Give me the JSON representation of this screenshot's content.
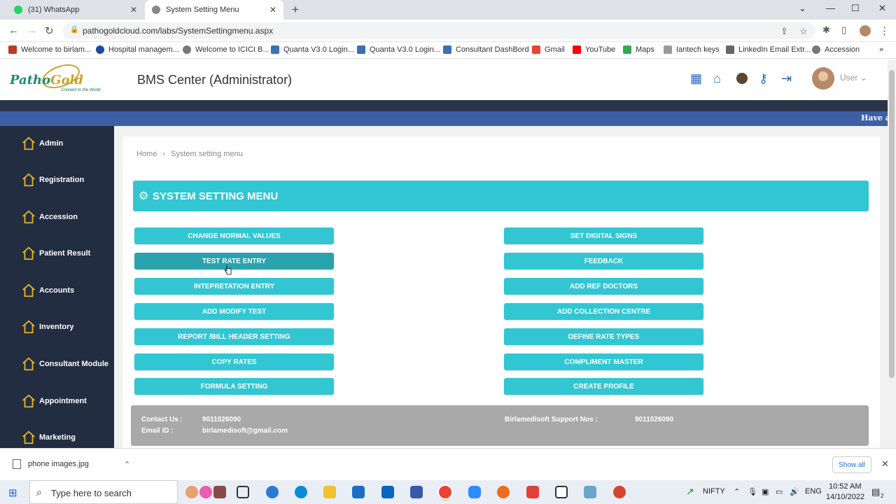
{
  "browser": {
    "tabs": [
      {
        "title": "(31) WhatsApp",
        "active": false
      },
      {
        "title": "System Setting Menu",
        "active": true
      }
    ],
    "url": "pathogoldcloud.com/labs/SystemSettingmenu.aspx",
    "bookmarks": [
      "Welcome to birlam...",
      "Hospital managem...",
      "Welcome to ICICI B...",
      "Quanta V3.0 Login...",
      "Quanta V3.0 Login...",
      "Consultant DashBord",
      "Gmail",
      "YouTube",
      "Maps",
      "Iantech keys",
      "LinkedIn Email Extr...",
      "Accession"
    ]
  },
  "header": {
    "logo_main": "Patho",
    "logo_accent": "Gold",
    "logo_tagline": "Connect to the World",
    "center_title": "BMS Center (Administrator)",
    "user_label": "User"
  },
  "marquee": "Have a",
  "sidebar": {
    "items": [
      {
        "label": "Admin"
      },
      {
        "label": "Registration"
      },
      {
        "label": "Accession"
      },
      {
        "label": "Patient Result"
      },
      {
        "label": "Accounts"
      },
      {
        "label": "Inventory"
      },
      {
        "label": "Consultant Module"
      },
      {
        "label": "Appointment"
      },
      {
        "label": "Marketing"
      }
    ]
  },
  "breadcrumb": {
    "home": "Home",
    "current": "System setting menu"
  },
  "menu": {
    "title": "SYSTEM SETTING MENU",
    "left_buttons": [
      "CHANGE NORMAL VALUES",
      "TEST RATE ENTRY",
      "INTEPRETATION ENTRY",
      "ADD MODIFY TEST",
      "REPORT /BILL HEADER SETTING",
      "COPY RATES",
      "FORMULA SETTING"
    ],
    "right_buttons": [
      "SET DIGITAL SIGNS",
      "FEEDBACK",
      "ADD REF DOCTORS",
      "ADD COLLECTION CENTRE",
      "DEFINE RATE TYPES",
      "COMPLIMENT MASTER",
      "CREATE PROFILE"
    ]
  },
  "footer": {
    "contact_label": "Contact Us :",
    "contact_value": "9011026090",
    "email_label": "Email ID :",
    "email_value": "birlamedisoft@gmail.com",
    "support_label": "Birlamedisoft Support Nos :",
    "support_value": "9011026090"
  },
  "download": {
    "file": "phone images.jpg",
    "show_all": "Show all"
  },
  "taskbar": {
    "search_placeholder": "Type here to search",
    "nifty": "NIFTY",
    "lang": "ENG",
    "time": "10:52 AM",
    "date": "14/10/2022",
    "notif_count": "2"
  },
  "colors": {
    "accent": "#32c6d3",
    "sidebar": "#222d41",
    "marquee": "#3d5fa5",
    "footer": "#a9a9a9"
  }
}
